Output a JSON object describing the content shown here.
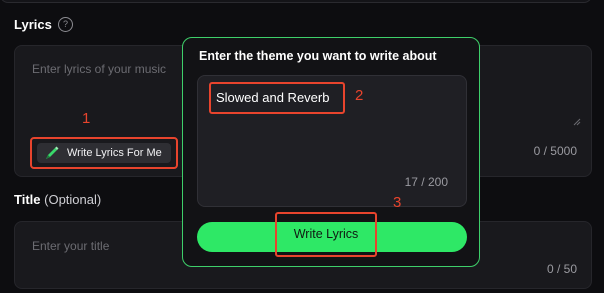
{
  "lyrics": {
    "label": "Lyrics",
    "help_icon": "question-circle-icon",
    "placeholder": "Enter lyrics of your music",
    "count": "0 / 5000",
    "write_button_label": "Write Lyrics For Me",
    "write_button_icon": "pen-icon"
  },
  "title": {
    "label": "Title",
    "optional": "(Optional)",
    "placeholder": "Enter your title",
    "count": "0 / 50"
  },
  "popover": {
    "heading": "Enter the theme you want to write about",
    "theme_value": "Slowed and Reverb",
    "theme_count": "17 / 200",
    "submit_label": "Write Lyrics"
  },
  "annotations": {
    "marker_1": "1",
    "marker_2": "2",
    "marker_3": "3"
  },
  "colors": {
    "accent_green": "#2ee866",
    "annotation_red": "#e8442d",
    "background": "#0d0d10"
  }
}
